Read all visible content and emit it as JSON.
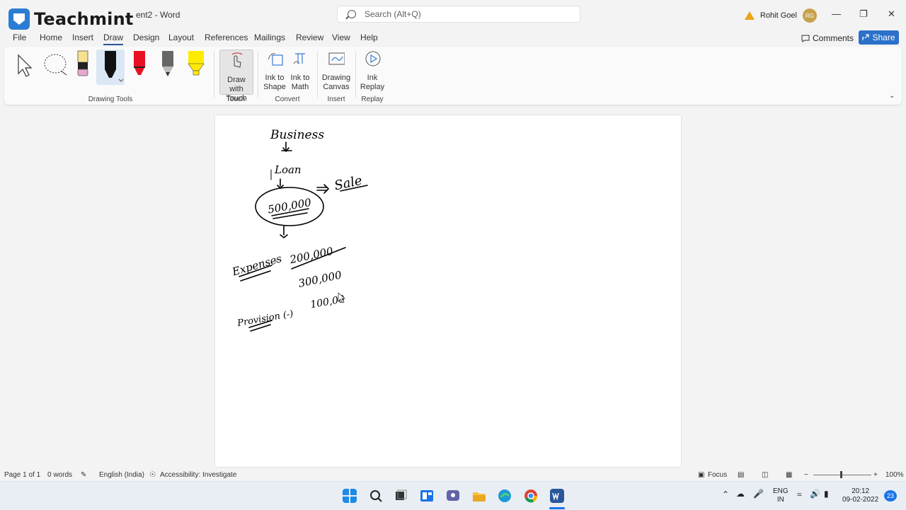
{
  "titlebar": {
    "logo_text": "Teachmint",
    "doc_title": "ent2 - Word",
    "search_placeholder": "Search (Alt+Q)",
    "user_name": "Rohit Goel",
    "user_initials": "RG"
  },
  "menu": {
    "items": [
      "File",
      "Home",
      "Insert",
      "Draw",
      "Design",
      "Layout",
      "References",
      "Mailings",
      "Review",
      "View",
      "Help"
    ],
    "active": "Draw",
    "comments_label": "Comments",
    "share_label": "Share"
  },
  "ribbon": {
    "drawing_tools_label": "Drawing Tools",
    "draw_with_touch_label": [
      "Draw with",
      "Touch"
    ],
    "touch_group_label": "Touch",
    "ink_to_shape_label": [
      "Ink to",
      "Shape"
    ],
    "ink_to_math_label": [
      "Ink to",
      "Math"
    ],
    "convert_group_label": "Convert",
    "drawing_canvas_label": [
      "Drawing",
      "Canvas"
    ],
    "insert_group_label": "Insert",
    "ink_replay_label": [
      "Ink",
      "Replay"
    ],
    "replay_group_label": "Replay",
    "pen_colors": [
      "#000000",
      "#e81123",
      "#555555",
      "#ffeb00"
    ],
    "highlighter_color": "#f5e06a"
  },
  "document": {
    "handwriting": {
      "line1": "Business",
      "line2": "Loan",
      "line3": "Sale",
      "circled": "500,000",
      "expenses_label": "Expenses",
      "expenses_value": "200,000",
      "remaining": "300,000",
      "provision_label": "Provision (-)",
      "provision_value": "100,00"
    }
  },
  "statusbar": {
    "page": "Page 1 of 1",
    "words": "0 words",
    "language": "English (India)",
    "accessibility": "Accessibility: Investigate",
    "focus": "Focus",
    "zoom": "100%"
  },
  "taskbar": {
    "lang_top": "ENG",
    "lang_bottom": "IN",
    "time": "20:12",
    "date": "09-02-2022",
    "notif_count": "23"
  }
}
